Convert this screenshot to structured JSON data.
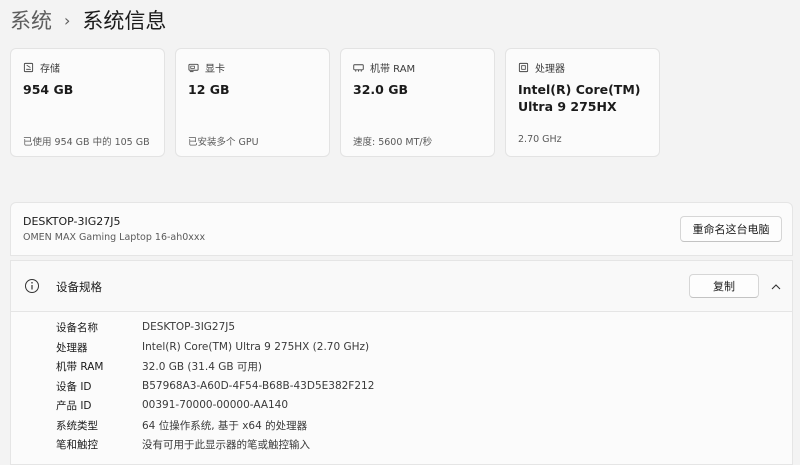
{
  "breadcrumb": {
    "parent": "系统",
    "separator": "›",
    "current": "系统信息"
  },
  "cards": [
    {
      "icon": "storage-icon",
      "label": "存储",
      "value": "954 GB",
      "sub": "已使用 954 GB 中的 105 GB"
    },
    {
      "icon": "gpu-icon",
      "label": "显卡",
      "value": "12 GB",
      "sub": "已安装多个 GPU"
    },
    {
      "icon": "ram-icon",
      "label": "机带 RAM",
      "value": "32.0 GB",
      "sub": "速度: 5600 MT/秒"
    },
    {
      "icon": "cpu-icon",
      "label": "处理器",
      "value": "Intel(R) Core(TM) Ultra 9 275HX",
      "sub": "2.70 GHz"
    }
  ],
  "device": {
    "name": "DESKTOP-3IG27J5",
    "model": "OMEN MAX Gaming Laptop 16-ah0xxx",
    "rename_label": "重命名这台电脑"
  },
  "specs": {
    "title": "设备规格",
    "copy_label": "复制",
    "rows": [
      {
        "label": "设备名称",
        "value": "DESKTOP-3IG27J5"
      },
      {
        "label": "处理器",
        "value": "Intel(R) Core(TM) Ultra 9 275HX (2.70 GHz)"
      },
      {
        "label": "机带 RAM",
        "value": "32.0 GB (31.4 GB 可用)"
      },
      {
        "label": "设备 ID",
        "value": "B57968A3-A60D-4F54-B68B-43D5E382F212"
      },
      {
        "label": "产品 ID",
        "value": "00391-70000-00000-AA140"
      },
      {
        "label": "系统类型",
        "value": "64 位操作系统, 基于 x64 的处理器"
      },
      {
        "label": "笔和触控",
        "value": "没有可用于此显示器的笔或触控输入"
      }
    ]
  }
}
